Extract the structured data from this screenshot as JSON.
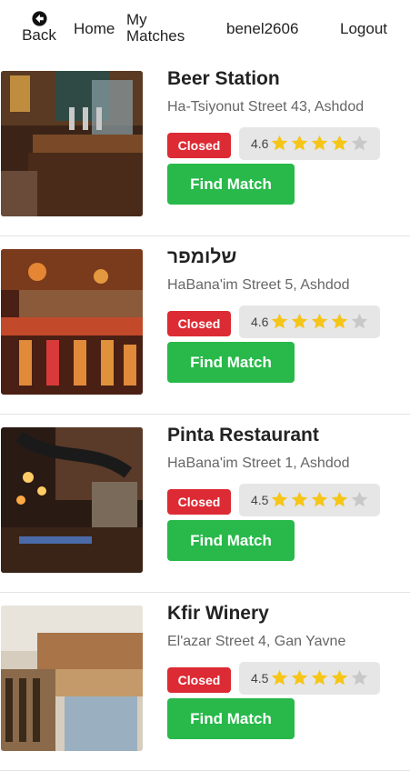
{
  "nav": {
    "back_label": "Back",
    "home_label": "Home",
    "my_matches_label": "My Matches",
    "username": "benel2606",
    "logout_label": "Logout"
  },
  "colors": {
    "closed_badge": "#dc2b34",
    "find_match_button": "#28b94a",
    "star_filled": "#f5c518",
    "star_empty": "#c8c8c8"
  },
  "venues": [
    {
      "name": "Beer Station",
      "address": "Ha-Tsiyonut Street 43, Ashdod",
      "status": "Closed",
      "rating": "4.6",
      "stars": {
        "filled": 4,
        "total": 5
      },
      "button_label": "Find Match"
    },
    {
      "name": "שלומפר",
      "address": "HaBana'im Street 5, Ashdod",
      "status": "Closed",
      "rating": "4.6",
      "stars": {
        "filled": 4,
        "total": 5
      },
      "button_label": "Find Match"
    },
    {
      "name": "Pinta Restaurant",
      "address": "HaBana'im Street 1, Ashdod",
      "status": "Closed",
      "rating": "4.5",
      "stars": {
        "filled": 4,
        "total": 5
      },
      "button_label": "Find Match"
    },
    {
      "name": "Kfir Winery",
      "address": "El'azar Street 4, Gan Yavne",
      "status": "Closed",
      "rating": "4.5",
      "stars": {
        "filled": 4,
        "total": 5
      },
      "button_label": "Find Match"
    }
  ]
}
